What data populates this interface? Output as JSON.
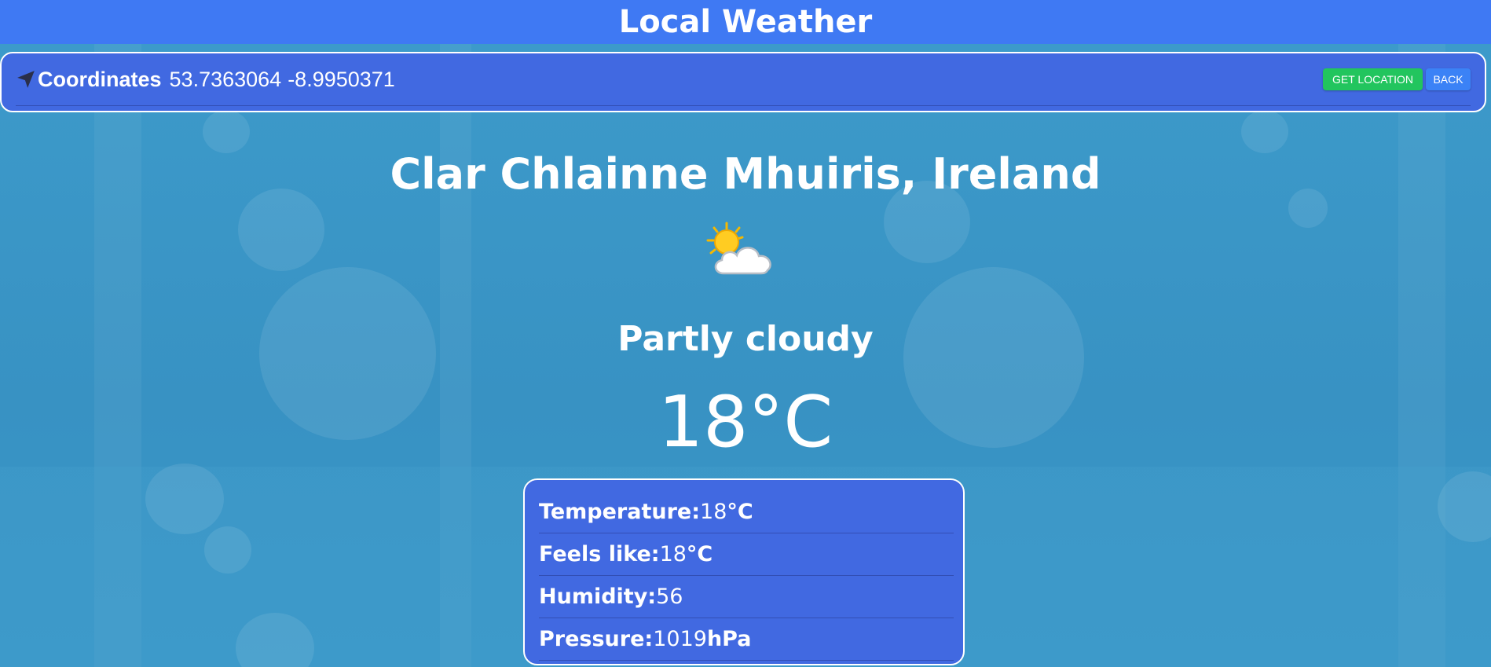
{
  "header": {
    "title": "Local Weather"
  },
  "coordinates": {
    "label": "Coordinates",
    "latitude": "53.7363064",
    "longitude": "-8.9950371",
    "get_location_label": "GET LOCATION",
    "back_label": "BACK"
  },
  "weather": {
    "location": "Clar Chlainne Mhuiris, Ireland",
    "icon": "partly-cloudy-icon",
    "condition": "Partly cloudy",
    "temperature": "18°C"
  },
  "details": [
    {
      "label": "Temperature:",
      "value": "18",
      "unit": "°C"
    },
    {
      "label": "Feels like:",
      "value": "18",
      "unit": "°C"
    },
    {
      "label": "Humidity:",
      "value": "56",
      "unit": ""
    },
    {
      "label": "Pressure:",
      "value": "1019",
      "unit": "hPa"
    }
  ],
  "colors": {
    "header": "#3f79f3",
    "panel": "#4169e1",
    "background": "#3a96c5",
    "get_location_button": "#22c55e",
    "back_button": "#3b82f6"
  }
}
